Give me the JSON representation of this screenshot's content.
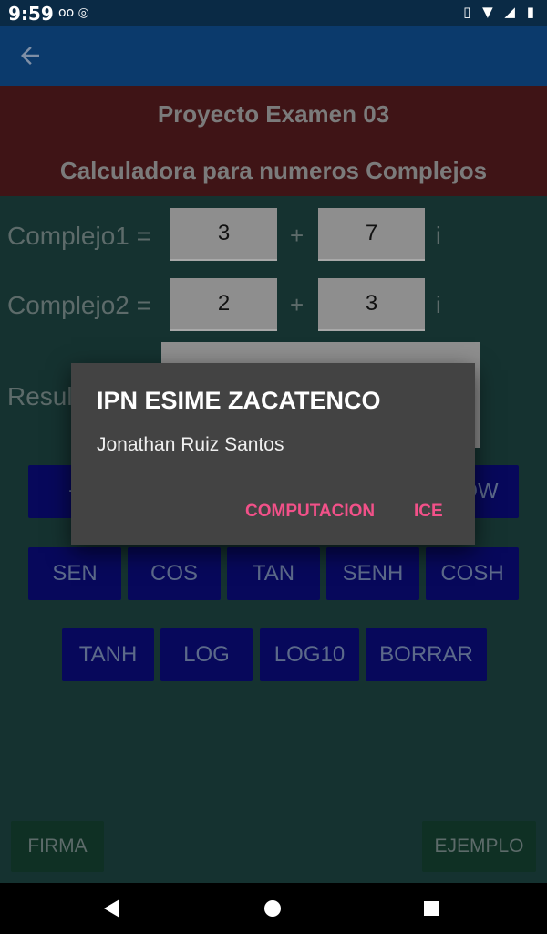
{
  "status": {
    "time": "9:59",
    "left_icons": "oo ◎",
    "right_icons": "▯ ▼ ◢ ▮"
  },
  "appbar": {
    "back_icon": "arrow-back-icon"
  },
  "header": {
    "title": "Proyecto Examen 03",
    "subtitle": "Calculadora para numeros Complejos"
  },
  "complex1": {
    "label": "Complejo1 =",
    "real": "3",
    "plus": "+",
    "imag": "7",
    "i": "i"
  },
  "complex2": {
    "label": "Complejo2 =",
    "real": "2",
    "plus": "+",
    "imag": "3",
    "i": "i"
  },
  "result": {
    "label": "Resul",
    "value": ""
  },
  "buttons_row1": {
    "left": "+",
    "right": "POW"
  },
  "buttons_row2": [
    "SEN",
    "COS",
    "TAN",
    "SENH",
    "COSH"
  ],
  "buttons_row3": [
    "TANH",
    "LOG",
    "LOG10",
    "BORRAR"
  ],
  "footer": {
    "firma": "FIRMA",
    "ejemplo": "EJEMPLO"
  },
  "dialog": {
    "title": "IPN ESIME ZACATENCO",
    "message": "Jonathan Ruiz Santos",
    "button1": "COMPUTACION",
    "button2": "ICE"
  },
  "colors": {
    "accent": "#f25189",
    "button_bg": "#07085b",
    "header_bg": "#3f1416"
  }
}
